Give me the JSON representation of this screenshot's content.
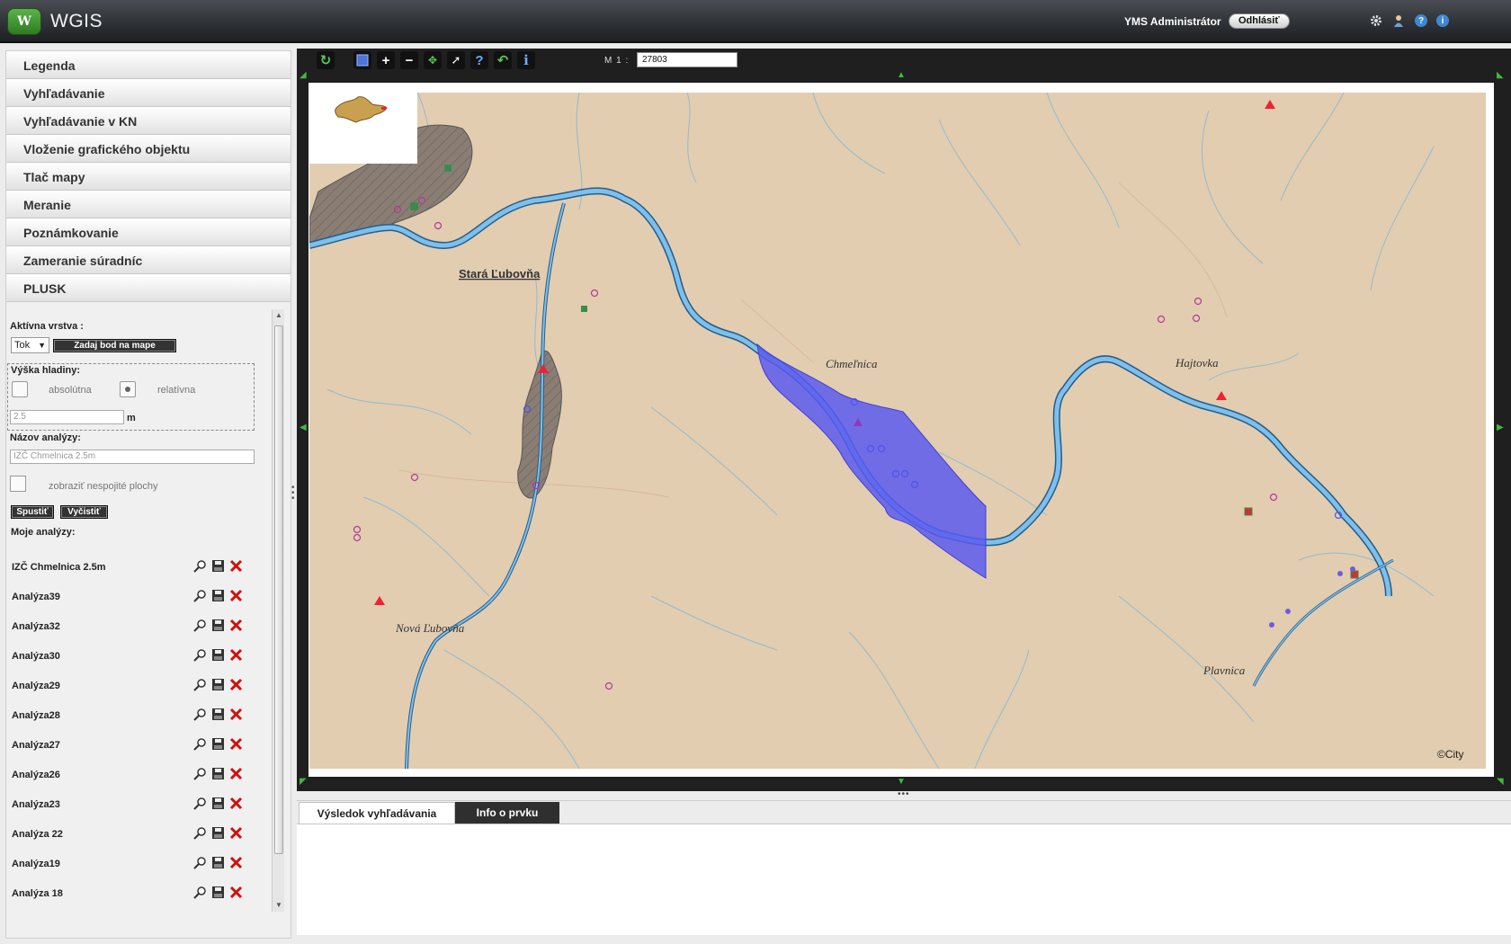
{
  "header": {
    "app_title": "WGIS",
    "logo_text": "W",
    "user_name": "YMS Administrátor",
    "logout_label": "Odhlásiť",
    "icons": [
      "gear-icon",
      "user-icon",
      "help-icon",
      "info-icon"
    ]
  },
  "sidebar": {
    "sections": [
      {
        "label": "Legenda"
      },
      {
        "label": "Vyhľadávanie"
      },
      {
        "label": "Vyhľadávanie v KN"
      },
      {
        "label": "Vloženie grafického objektu"
      },
      {
        "label": "Tlač mapy"
      },
      {
        "label": "Meranie"
      },
      {
        "label": "Poznámkovanie"
      },
      {
        "label": "Zameranie súradníc"
      },
      {
        "label": "PLUSK"
      }
    ],
    "plusk": {
      "active_layer_label": "Aktívna vrstva :",
      "layer_value": "Tok",
      "pick_point_label": "Zadaj bod na mape",
      "water_level_label": "Výška hladiny:",
      "absolute_label": "absolútna",
      "relative_label": "relatívna",
      "level_value": "2.5",
      "level_unit": "m",
      "analysis_name_label": "Názov analýzy:",
      "analysis_name_value": "IZČ Chmelnica 2.5m",
      "show_disjoint_label": "zobraziť nespojité plochy",
      "run_label": "Spustiť",
      "clear_label": "Vyčistiť",
      "my_analyses_label": "Moje analýzy:",
      "analyses": [
        {
          "name": "IZČ Chmelnica 2.5m"
        },
        {
          "name": "Analýza39"
        },
        {
          "name": "Analýza32"
        },
        {
          "name": "Analýza30"
        },
        {
          "name": "Analýza29"
        },
        {
          "name": "Analýza28"
        },
        {
          "name": "Analýza27"
        },
        {
          "name": "Analýza26"
        },
        {
          "name": "Analýza23"
        },
        {
          "name": "Analýza 22"
        },
        {
          "name": "Analýza19"
        },
        {
          "name": "Analýza 18"
        }
      ]
    }
  },
  "map": {
    "scale_label": "M 1 :",
    "scale_value": "27803",
    "toolbar_icons": [
      "refresh-icon",
      "select-icon",
      "zoom-in-icon",
      "zoom-out-icon",
      "full-extent-icon",
      "pan-icon",
      "help-icon",
      "undo-icon",
      "info-icon"
    ],
    "places": [
      "Stará Ľubovňa",
      "Chmeľnica",
      "Hajtovka",
      "Nová Ľubovňa",
      "Plavnica"
    ],
    "copyright": "©City",
    "colors": {
      "terrain": "#e2cdb0",
      "river": "#6fb0e0",
      "flood": "#5a5af0",
      "urban": "#8a7e74"
    }
  },
  "bottom": {
    "tabs": [
      {
        "label": "Výsledok vyhľadávania"
      },
      {
        "label": "Info o prvku"
      }
    ]
  }
}
